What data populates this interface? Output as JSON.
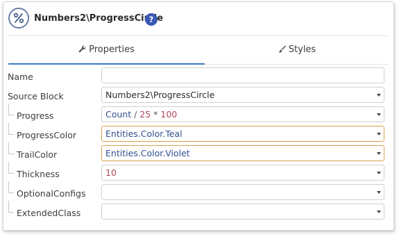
{
  "header": {
    "title": "Numbers2\\ProgressCircle",
    "help": "?"
  },
  "tabs": [
    {
      "label": "Properties",
      "icon": "wrench-icon",
      "active": true
    },
    {
      "label": "Styles",
      "icon": "brush-icon",
      "active": false
    }
  ],
  "props": {
    "name": {
      "label": "Name",
      "value": ""
    },
    "source_block": {
      "label": "Source Block",
      "value": "Numbers2\\ProgressCircle"
    },
    "progress": {
      "label": "Progress",
      "tokens": {
        "var": "Count",
        "op1": " / ",
        "num1": "25",
        "op2": " * ",
        "num2": "100"
      }
    },
    "progress_color": {
      "label": "ProgressColor",
      "value": "Entities.Color.Teal"
    },
    "trail_color": {
      "label": "TrailColor",
      "value": "Entities.Color.Violet"
    },
    "thickness": {
      "label": "Thickness",
      "value": "10"
    },
    "optional_configs": {
      "label": "OptionalConfigs",
      "value": ""
    },
    "extended_class": {
      "label": "ExtendedClass",
      "value": ""
    }
  },
  "colors": {
    "accent": "#3b78c4",
    "help_badge": "#3b59b5",
    "highlight_border": "#d6a04c",
    "number": "#b0465a"
  }
}
